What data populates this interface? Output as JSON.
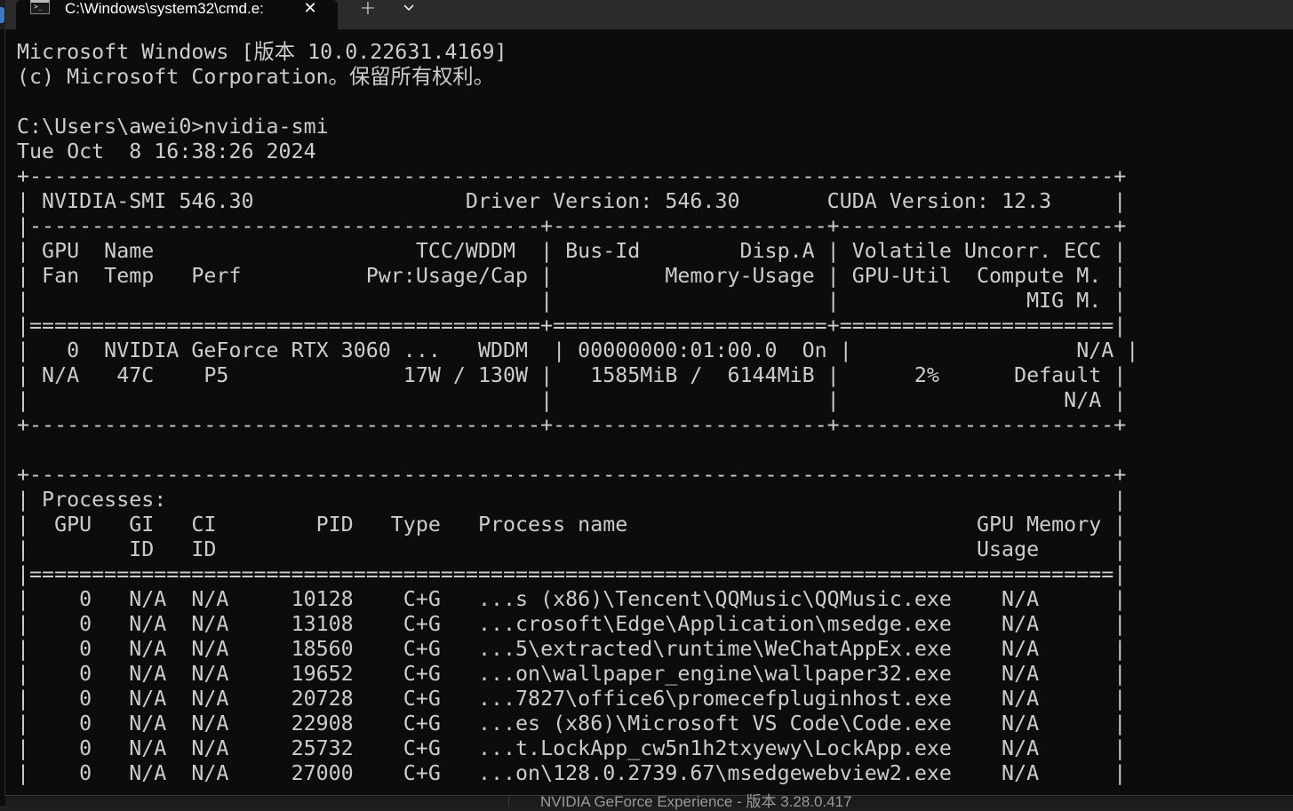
{
  "tab": {
    "title": "C:\\Windows\\system32\\cmd.e:",
    "icon": "cmd-prompt-icon",
    "close_glyph": "✕",
    "new_tab_glyph": "+"
  },
  "console": {
    "lines": [
      "Microsoft Windows [版本 10.0.22631.4169]",
      "(c) Microsoft Corporation。保留所有权利。",
      "",
      "C:\\Users\\awei0>nvidia-smi",
      "Tue Oct  8 16:38:26 2024",
      "+---------------------------------------------------------------------------------------+",
      "| NVIDIA-SMI 546.30                 Driver Version: 546.30       CUDA Version: 12.3     |",
      "|-----------------------------------------+----------------------+----------------------+",
      "| GPU  Name                     TCC/WDDM  | Bus-Id        Disp.A | Volatile Uncorr. ECC |",
      "| Fan  Temp   Perf          Pwr:Usage/Cap |         Memory-Usage | GPU-Util  Compute M. |",
      "|                                         |                      |               MIG M. |",
      "|=========================================+======================+======================|",
      "|   0  NVIDIA GeForce RTX 3060 ...   WDDM  | 00000000:01:00.0  On |                  N/A |",
      "| N/A   47C    P5              17W / 130W |   1585MiB /  6144MiB |      2%      Default |",
      "|                                         |                      |                  N/A |",
      "+-----------------------------------------+----------------------+----------------------+",
      "",
      "+---------------------------------------------------------------------------------------+",
      "| Processes:                                                                            |",
      "|  GPU   GI   CI        PID   Type   Process name                            GPU Memory |",
      "|        ID   ID                                                             Usage      |",
      "|=======================================================================================|",
      "|    0   N/A  N/A     10128    C+G   ...s (x86)\\Tencent\\QQMusic\\QQMusic.exe    N/A      |",
      "|    0   N/A  N/A     13108    C+G   ...crosoft\\Edge\\Application\\msedge.exe    N/A      |",
      "|    0   N/A  N/A     18560    C+G   ...5\\extracted\\runtime\\WeChatAppEx.exe    N/A      |",
      "|    0   N/A  N/A     19652    C+G   ...on\\wallpaper_engine\\wallpaper32.exe    N/A      |",
      "|    0   N/A  N/A     20728    C+G   ...7827\\office6\\promecefpluginhost.exe    N/A      |",
      "|    0   N/A  N/A     22908    C+G   ...es (x86)\\Microsoft VS Code\\Code.exe    N/A      |",
      "|    0   N/A  N/A     25732    C+G   ...t.LockApp_cw5n1h2txyewy\\LockApp.exe    N/A      |",
      "|    0   N/A  N/A     27000    C+G   ...on\\128.0.2739.67\\msedgewebview2.exe    N/A      |"
    ]
  },
  "background_window": {
    "title": "NVIDIA GeForce Experience - 版本 3.28.0.417"
  },
  "colors": {
    "console_bg": "#0c0c0c",
    "console_fg": "#cccccc",
    "tabbar_bg": "#2b2b2b"
  }
}
